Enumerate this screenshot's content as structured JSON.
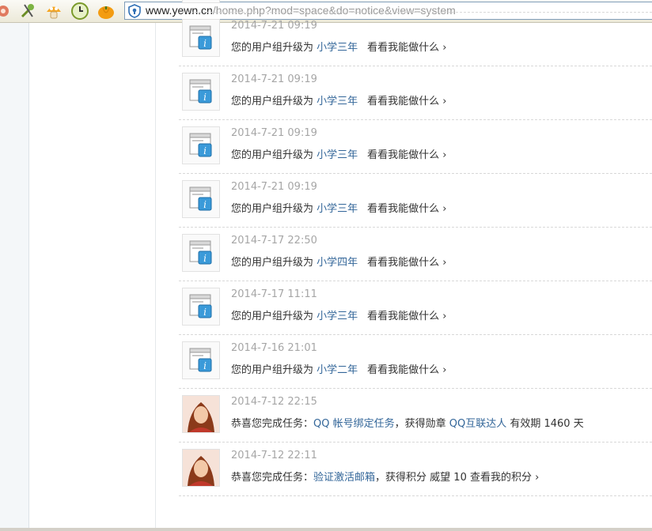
{
  "browser": {
    "url_host": "www.yewn.cn",
    "url_path": "/home.php?mod=space&do=notice&view=system",
    "toolbar_icons": [
      "gear-icon",
      "tools-icon",
      "mushroom-icon",
      "clock-icon",
      "pumpkin-icon"
    ]
  },
  "notices": [
    {
      "time": "",
      "prefix": "您的用户组升级为",
      "group": "小学三年",
      "action": "看看我能做什么 ›",
      "avatar": "system-notice-icon"
    },
    {
      "time": "2014-7-21 09:19",
      "prefix": "您的用户组升级为",
      "group": "小学三年",
      "action": "看看我能做什么 ›",
      "avatar": "system-notice-icon"
    },
    {
      "time": "2014-7-21 09:19",
      "prefix": "您的用户组升级为",
      "group": "小学三年",
      "action": "看看我能做什么 ›",
      "avatar": "system-notice-icon"
    },
    {
      "time": "2014-7-21 09:19",
      "prefix": "您的用户组升级为",
      "group": "小学三年",
      "action": "看看我能做什么 ›",
      "avatar": "system-notice-icon"
    },
    {
      "time": "2014-7-21 09:19",
      "prefix": "您的用户组升级为",
      "group": "小学三年",
      "action": "看看我能做什么 ›",
      "avatar": "system-notice-icon"
    },
    {
      "time": "2014-7-17 22:50",
      "prefix": "您的用户组升级为",
      "group": "小学四年",
      "action": "看看我能做什么 ›",
      "avatar": "system-notice-icon"
    },
    {
      "time": "2014-7-17 11:11",
      "prefix": "您的用户组升级为",
      "group": "小学三年",
      "action": "看看我能做什么 ›",
      "avatar": "system-notice-icon"
    },
    {
      "time": "2014-7-16 21:01",
      "prefix": "您的用户组升级为",
      "group": "小学二年",
      "action": "看看我能做什么 ›",
      "avatar": "system-notice-icon"
    }
  ],
  "task_notices": [
    {
      "time": "2014-7-12 22:15",
      "pre": "恭喜您完成任务：",
      "task": "QQ 帐号绑定任务",
      "mid": "，获得勋章 ",
      "reward": "QQ互联达人",
      "post": " 有效期 1460 天",
      "avatar": "user-avatar"
    },
    {
      "time": "2014-7-12 22:11",
      "pre": "恭喜您完成任务：",
      "task": "验证激活邮箱",
      "mid": "，获得积分 威望 10",
      "reward": "",
      "post": "  查看我的积分 ›",
      "avatar": "user-avatar"
    }
  ],
  "colors": {
    "link": "#336699",
    "time": "#a6a6a6"
  }
}
